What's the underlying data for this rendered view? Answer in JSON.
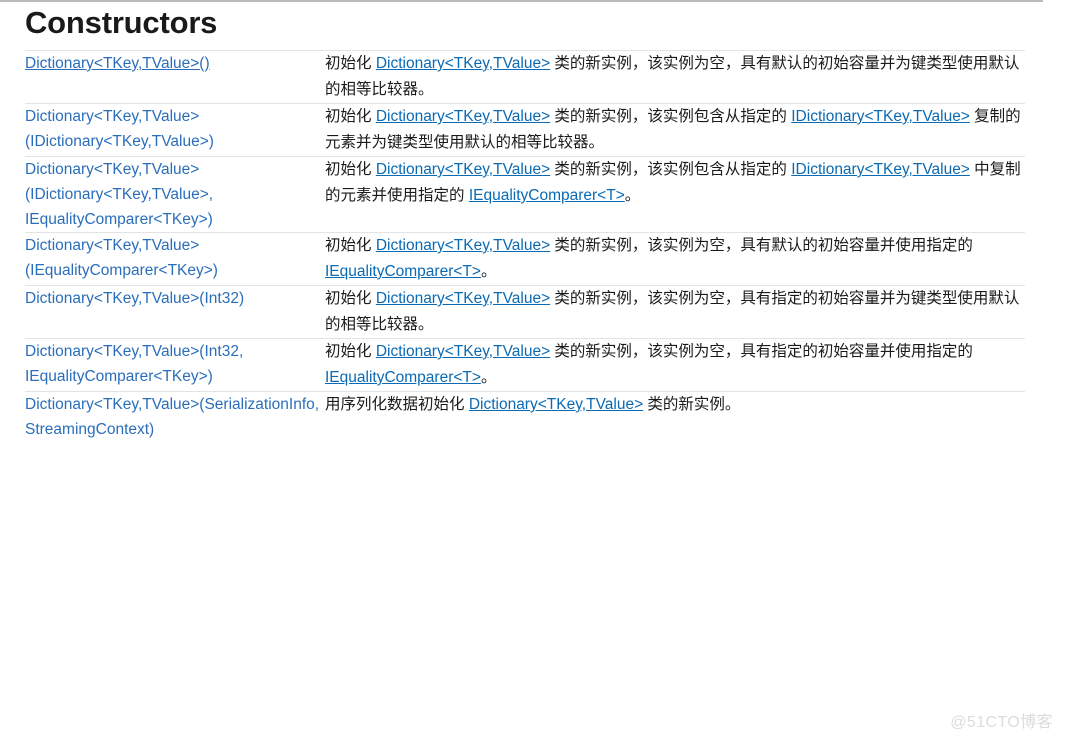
{
  "document": {
    "heading": "Constructors",
    "watermark": "@51CTO博客"
  },
  "colors": {
    "link": "#2a6ebb",
    "inline_link": "#0a6ab4",
    "text": "#1a1a1a",
    "rule": "#e3e3e3",
    "top_rule": "#b9b9b9",
    "watermark": "#dcdcdc",
    "background": "#ffffff"
  },
  "table": {
    "rows": [
      {
        "signature": {
          "underlined": true,
          "parts": [
            {
              "type": "link",
              "text": "Dictionary<TKey,TValue>()"
            }
          ]
        },
        "description": {
          "parts": [
            {
              "type": "text",
              "text": "初始化 "
            },
            {
              "type": "link",
              "text": "Dictionary<TKey,TValue>"
            },
            {
              "type": "text",
              "text": " 类的新实例，该实例为空，具有默认的初始容量并为键类型使用默认的相等比较器。"
            }
          ]
        }
      },
      {
        "signature": {
          "underlined": false,
          "parts": [
            {
              "type": "link",
              "text": "Dictionary<TKey,TValue>(IDictionary<TKey,TValue>)"
            }
          ]
        },
        "description": {
          "parts": [
            {
              "type": "text",
              "text": "初始化 "
            },
            {
              "type": "link",
              "text": "Dictionary<TKey,TValue>"
            },
            {
              "type": "text",
              "text": " 类的新实例，该实例包含从指定的 "
            },
            {
              "type": "link",
              "text": "IDictionary<TKey,TValue>"
            },
            {
              "type": "text",
              "text": " 复制的元素并为键类型使用默认的相等比较器。"
            }
          ]
        }
      },
      {
        "signature": {
          "underlined": false,
          "parts": [
            {
              "type": "link",
              "text": "Dictionary<TKey,TValue>(IDictionary<TKey,TValue>, IEqualityComparer<TKey>)"
            }
          ]
        },
        "description": {
          "parts": [
            {
              "type": "text",
              "text": "初始化 "
            },
            {
              "type": "link",
              "text": "Dictionary<TKey,TValue>"
            },
            {
              "type": "text",
              "text": " 类的新实例，该实例包含从指定的 "
            },
            {
              "type": "link",
              "text": "IDictionary<TKey,TValue>"
            },
            {
              "type": "text",
              "text": " 中复制的元素并使用指定的 "
            },
            {
              "type": "link",
              "text": "IEqualityComparer<T>"
            },
            {
              "type": "text",
              "text": "。"
            }
          ]
        }
      },
      {
        "signature": {
          "underlined": false,
          "parts": [
            {
              "type": "link",
              "text": "Dictionary<TKey,TValue>(IEqualityComparer<TKey>)"
            }
          ]
        },
        "description": {
          "parts": [
            {
              "type": "text",
              "text": "初始化 "
            },
            {
              "type": "link",
              "text": "Dictionary<TKey,TValue>"
            },
            {
              "type": "text",
              "text": " 类的新实例，该实例为空，具有默认的初始容量并使用指定的 "
            },
            {
              "type": "link",
              "text": "IEqualityComparer<T>"
            },
            {
              "type": "text",
              "text": "。"
            }
          ]
        }
      },
      {
        "signature": {
          "underlined": false,
          "parts": [
            {
              "type": "link",
              "text": "Dictionary<TKey,TValue>(Int32)"
            }
          ]
        },
        "description": {
          "parts": [
            {
              "type": "text",
              "text": "初始化 "
            },
            {
              "type": "link",
              "text": "Dictionary<TKey,TValue>"
            },
            {
              "type": "text",
              "text": " 类的新实例，该实例为空，具有指定的初始容量并为键类型使用默认的相等比较器。"
            }
          ]
        }
      },
      {
        "signature": {
          "underlined": false,
          "parts": [
            {
              "type": "link",
              "text": "Dictionary<TKey,TValue>(Int32, IEqualityComparer<TKey>)"
            }
          ]
        },
        "description": {
          "parts": [
            {
              "type": "text",
              "text": "初始化 "
            },
            {
              "type": "link",
              "text": "Dictionary<TKey,TValue>"
            },
            {
              "type": "text",
              "text": " 类的新实例，该实例为空，具有指定的初始容量并使用指定的 "
            },
            {
              "type": "link",
              "text": "IEqualityComparer<T>"
            },
            {
              "type": "text",
              "text": "。"
            }
          ]
        }
      },
      {
        "signature": {
          "underlined": false,
          "parts": [
            {
              "type": "link",
              "text": "Dictionary<TKey,TValue>(SerializationInfo, StreamingContext)"
            }
          ]
        },
        "description": {
          "parts": [
            {
              "type": "text",
              "text": "用序列化数据初始化 "
            },
            {
              "type": "link",
              "text": "Dictionary<TKey,TValue>"
            },
            {
              "type": "text",
              "text": " 类的新实例。"
            }
          ]
        }
      }
    ]
  }
}
